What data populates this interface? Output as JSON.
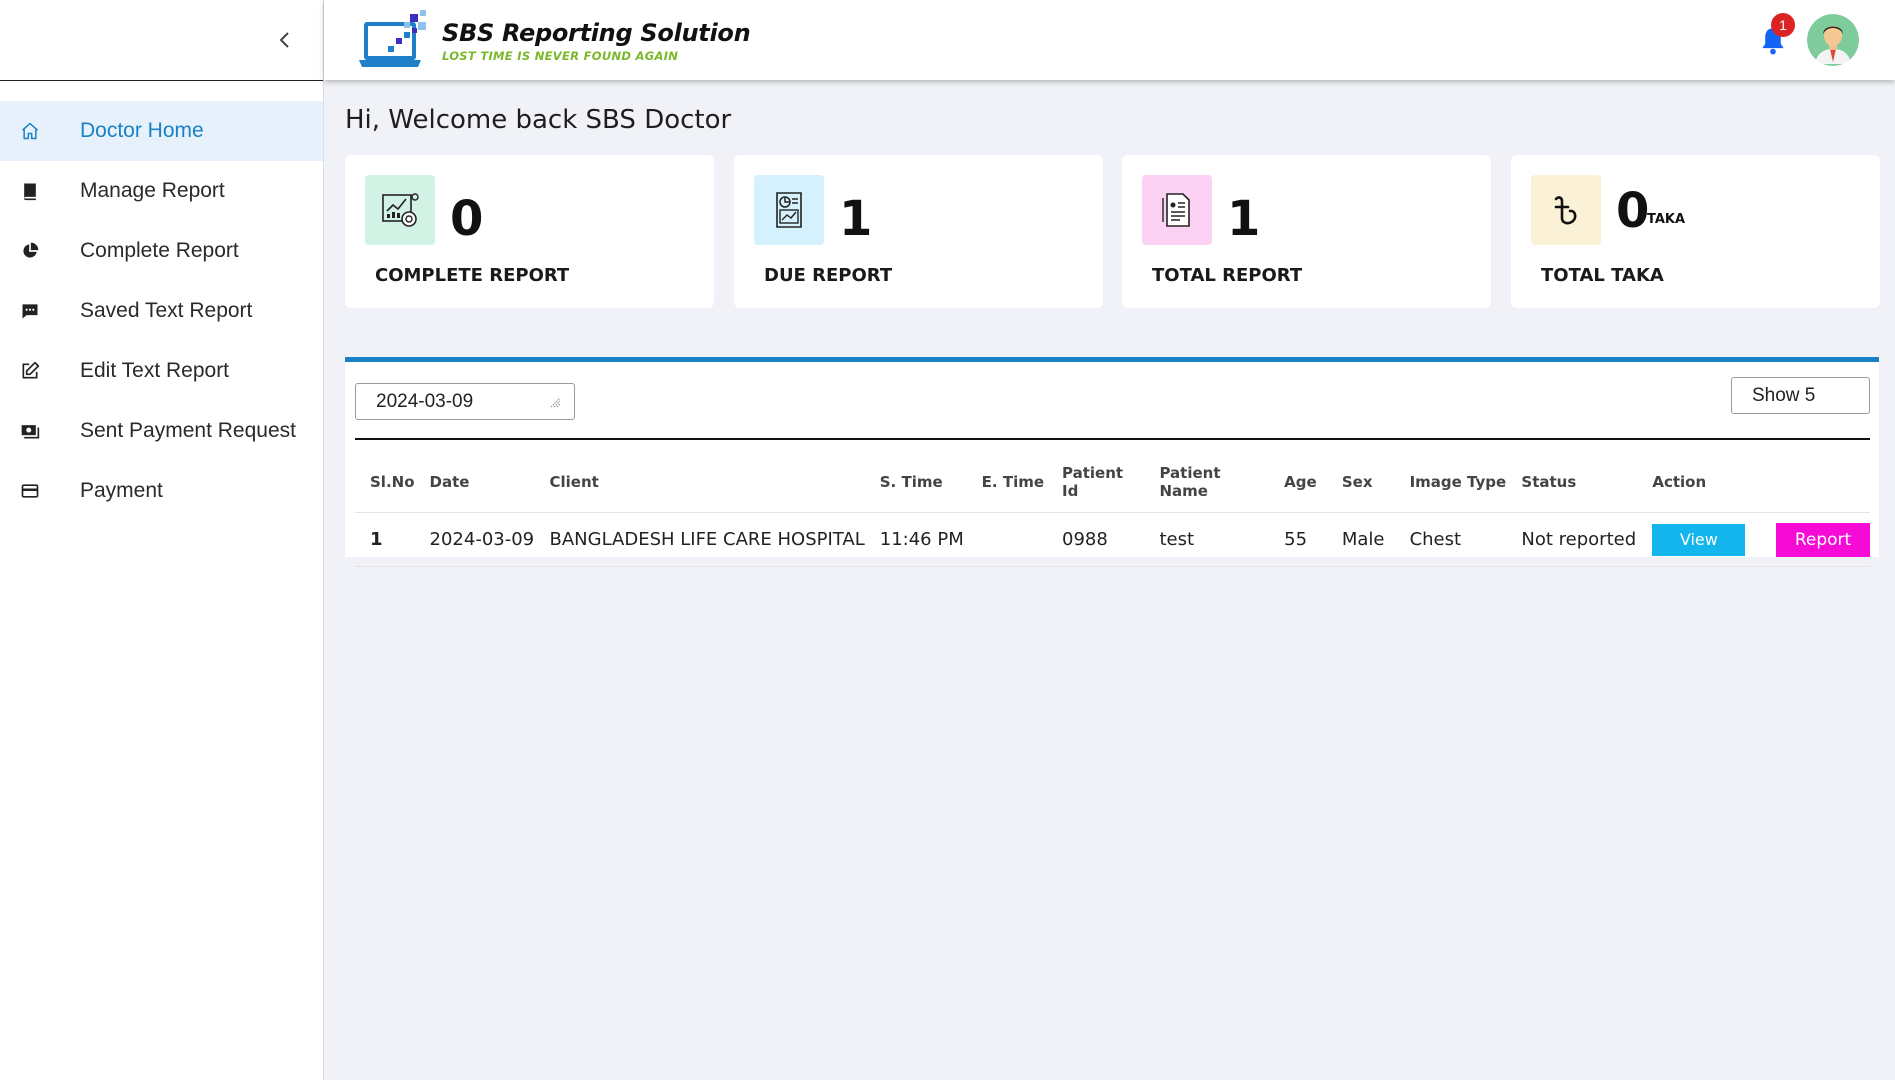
{
  "app": {
    "title": "SBS Reporting Solution",
    "tagline": "LOST TIME IS NEVER FOUND AGAIN"
  },
  "header": {
    "notification_count": "1"
  },
  "sidebar": {
    "items": [
      {
        "label": "Doctor Home",
        "icon": "home-icon",
        "active": true
      },
      {
        "label": "Manage Report",
        "icon": "book-icon"
      },
      {
        "label": "Complete Report",
        "icon": "pie-chart-icon"
      },
      {
        "label": "Saved Text Report",
        "icon": "message-icon"
      },
      {
        "label": "Edit Text Report",
        "icon": "edit-icon"
      },
      {
        "label": "Sent Payment Request",
        "icon": "money-icon"
      },
      {
        "label": "Payment",
        "icon": "credit-card-icon"
      }
    ]
  },
  "main": {
    "welcome": "Hi, Welcome back SBS Doctor",
    "cards": [
      {
        "value": "0",
        "label": "COMPLETE REPORT",
        "icon": "analytics-report-icon",
        "bg": "#d3f2e6"
      },
      {
        "value": "1",
        "label": "DUE REPORT",
        "icon": "chart-document-icon",
        "bg": "#d4f1fd"
      },
      {
        "value": "1",
        "label": "TOTAL REPORT",
        "icon": "document-list-icon",
        "bg": "#fcd2f4"
      },
      {
        "value": "0",
        "unit": "TAKA",
        "label": "TOTAL TAKA",
        "icon": "taka-icon",
        "bg": "#fbf1d6"
      }
    ],
    "filter": {
      "date": "2024-03-09",
      "show": "Show 5"
    },
    "table": {
      "headers": [
        "Sl.No",
        "Date",
        "Client",
        "S. Time",
        "E. Time",
        "Patient Id",
        "Patient Name",
        "Age",
        "Sex",
        "Image Type",
        "Status",
        "Action"
      ],
      "rows": [
        {
          "sl": "1",
          "date": "2024-03-09",
          "client": "BANGLADESH LIFE CARE HOSPITAL",
          "s_time": "11:46 PM",
          "e_time": "",
          "patient_id": "0988",
          "patient_name": "test",
          "age": "55",
          "sex": "Male",
          "image_type": "Chest",
          "status": "Not reported",
          "view_label": "View",
          "report_label": "Report"
        }
      ]
    }
  },
  "colors": {
    "accent": "#1a82c4",
    "view_button": "#12b5ec",
    "report_button": "#f60ad5",
    "badge": "#dc2323"
  }
}
